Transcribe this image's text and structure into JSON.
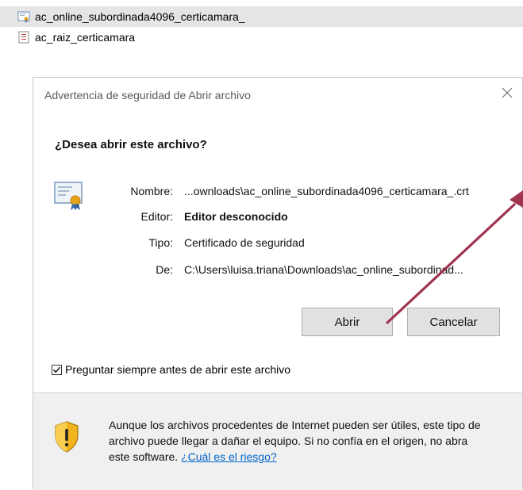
{
  "files": [
    {
      "name": "ac_online_subordinada4096_certicamara_",
      "icon": "certificate-file-icon",
      "selected": true
    },
    {
      "name": "ac_raiz_certicamara",
      "icon": "document-file-icon",
      "selected": false
    }
  ],
  "dialog": {
    "title": "Advertencia de seguridad de Abrir archivo",
    "question": "¿Desea abrir este archivo?",
    "fields": [
      {
        "label": "Nombre:",
        "value": "...ownloads\\ac_online_subordinada4096_certicamara_.crt"
      },
      {
        "label": "Editor:",
        "value": "Editor desconocido"
      },
      {
        "label": "Tipo:",
        "value": "Certificado de seguridad"
      },
      {
        "label": "De:",
        "value": "C:\\Users\\luisa.triana\\Downloads\\ac_online_subordinad..."
      }
    ],
    "open_button": "Abrir",
    "cancel_button": "Cancelar",
    "checkbox_label": "Preguntar siempre antes de abrir este archivo",
    "checkbox_checked": true,
    "warning_text": "Aunque los archivos procedentes de Internet pueden ser útiles, este tipo de archivo puede llegar a dañar el equipo. Si no confía en el origen, no abra este software.",
    "risk_link": "¿Cuál es el riesgo?"
  },
  "colors": {
    "annotation_arrow": "#a0344f",
    "link": "#0066cc",
    "selected_row": "#e5e5e5"
  }
}
